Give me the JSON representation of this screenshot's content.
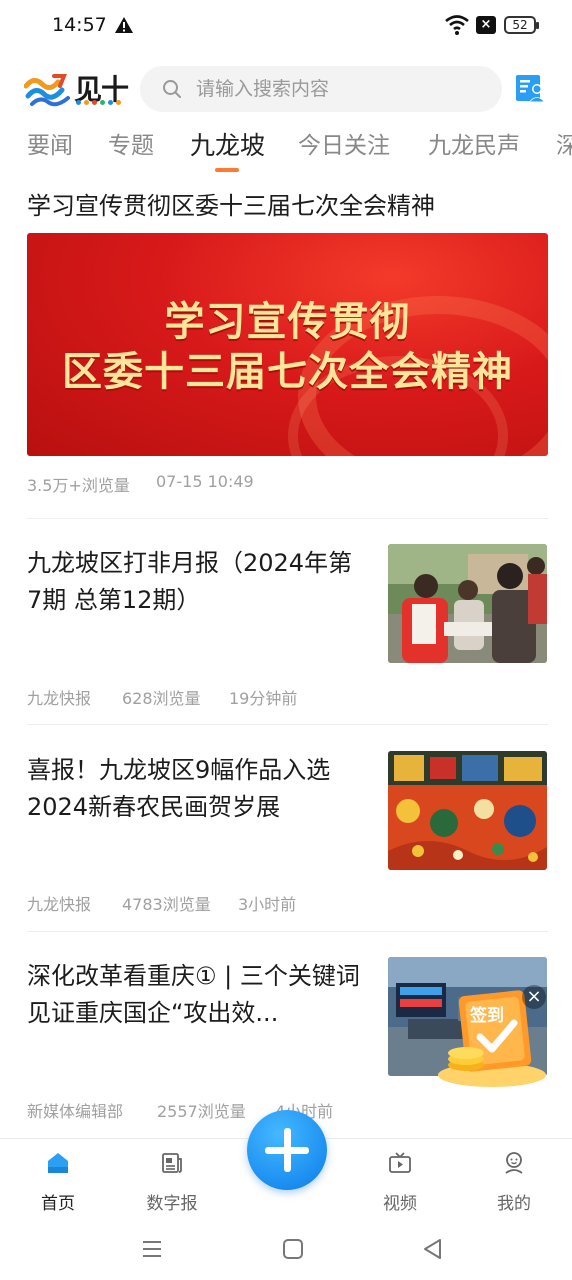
{
  "status_bar": {
    "time": "14:57",
    "battery": "52",
    "icons": [
      "warning-icon",
      "wifi-icon",
      "sim-blocked-icon",
      "battery-icon"
    ]
  },
  "header": {
    "logo_text": "见十",
    "search_placeholder": "请输入搜索内容"
  },
  "tabs": [
    {
      "label": "要闻",
      "active": false
    },
    {
      "label": "专题",
      "active": false
    },
    {
      "label": "九龙坡",
      "active": true
    },
    {
      "label": "今日关注",
      "active": false
    },
    {
      "label": "九龙民声",
      "active": false
    },
    {
      "label": "深",
      "active": false
    }
  ],
  "feed": {
    "featured": {
      "title": "学习宣传贯彻区委十三届七次全会精神",
      "banner_line1": "学习宣传贯彻",
      "banner_line2": "区委十三届七次全会精神",
      "views": "3.5万+浏览量",
      "time": "07-15 10:49"
    },
    "articles": [
      {
        "title": "九龙坡区打非月报（2024年第7期 总第12期）",
        "source": "九龙快报",
        "views": "628浏览量",
        "time": "19分钟前"
      },
      {
        "title": "喜报！九龙坡区9幅作品入选2024新春农民画贺岁展",
        "source": "九龙快报",
        "views": "4783浏览量",
        "time": "3小时前"
      },
      {
        "title": "深化改革看重庆① | 三个关键词 见证重庆国企“攻出效...",
        "source": "新媒体编辑部",
        "views": "2557浏览量",
        "time": "4小时前"
      }
    ]
  },
  "signin_badge": {
    "label": "签到",
    "close": "×"
  },
  "bottom_nav": [
    {
      "label": "首页",
      "icon": "home-icon",
      "active": true
    },
    {
      "label": "数字报",
      "icon": "newspaper-icon",
      "active": false
    },
    {
      "label": "视频",
      "icon": "tv-icon",
      "active": false
    },
    {
      "label": "我的",
      "icon": "user-icon",
      "active": false
    }
  ],
  "colors": {
    "accent": "#ff7a2f",
    "brand_blue": "#1b8ff0",
    "banner_red": "#d8191a",
    "banner_text": "#ffe69a"
  }
}
